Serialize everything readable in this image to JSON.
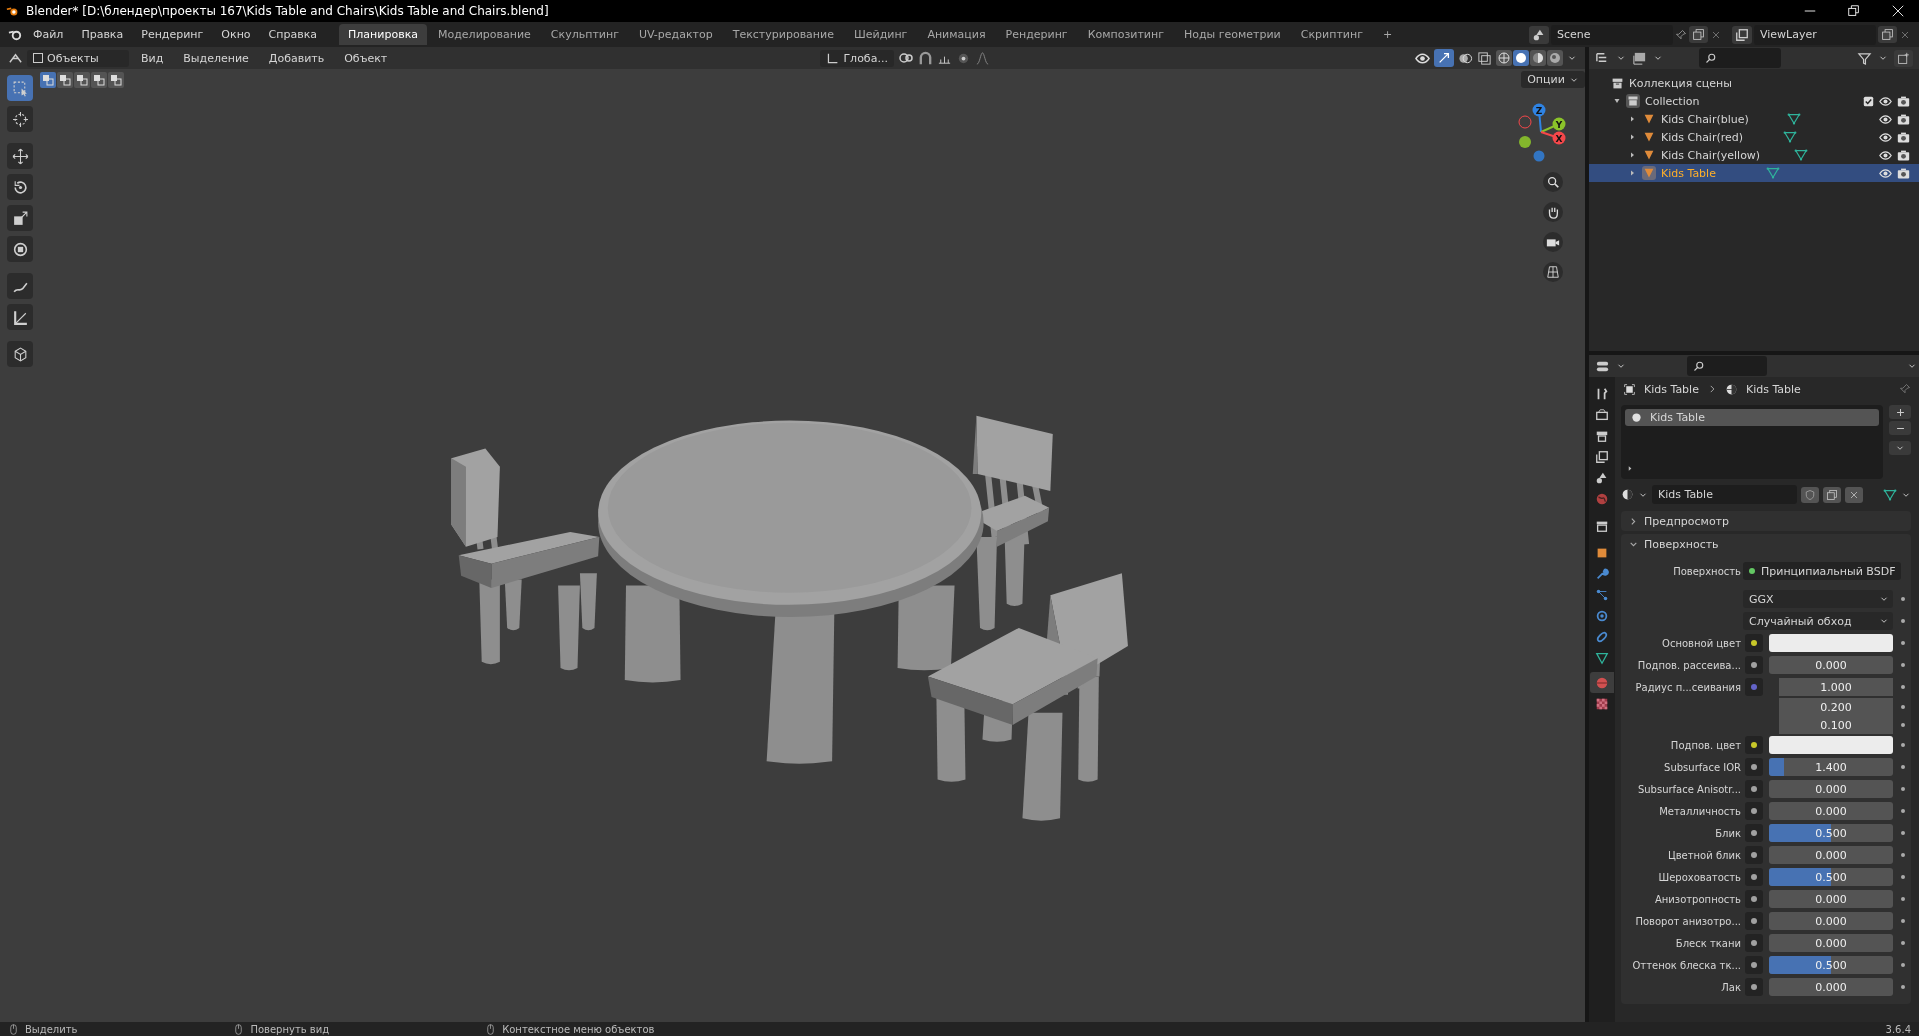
{
  "window": {
    "title": "Blender* [D:\\блендер\\проекты 167\\Kids Table and Chairs\\Kids Table and Chairs.blend]"
  },
  "menu": [
    "Файл",
    "Правка",
    "Рендеринг",
    "Окно",
    "Справка"
  ],
  "workspaces": [
    {
      "label": "Планировка",
      "selected": true
    },
    {
      "label": "Моделирование",
      "selected": false
    },
    {
      "label": "Скульптинг",
      "selected": false
    },
    {
      "label": "UV-редактор",
      "selected": false
    },
    {
      "label": "Текстурирование",
      "selected": false
    },
    {
      "label": "Шейдинг",
      "selected": false
    },
    {
      "label": "Анимация",
      "selected": false
    },
    {
      "label": "Рендеринг",
      "selected": false
    },
    {
      "label": "Композитинг",
      "selected": false
    },
    {
      "label": "Ноды геометрии",
      "selected": false
    },
    {
      "label": "Скриптинг",
      "selected": false
    }
  ],
  "add_workspace": "+",
  "scene": "Scene",
  "view_layer": "ViewLayer",
  "viewport": {
    "mode": "Объекты",
    "menus": [
      "Вид",
      "Выделение",
      "Добавить",
      "Объект"
    ],
    "orientation": "Глоба...",
    "options": "Опции",
    "select_modes": [
      {
        "selected": true
      },
      {
        "selected": false
      },
      {
        "selected": false
      },
      {
        "selected": false
      },
      {
        "selected": false
      }
    ],
    "tools": [
      {
        "kind": "select",
        "selected": true
      },
      {
        "kind": "cursor",
        "selected": false
      },
      {
        "kind": "move",
        "selected": false
      },
      {
        "kind": "rotate",
        "selected": false
      },
      {
        "kind": "scale",
        "selected": false
      },
      {
        "kind": "transform",
        "selected": false
      },
      {
        "kind": "annotate",
        "selected": false
      },
      {
        "kind": "measure",
        "selected": false
      },
      {
        "kind": "add-cube",
        "selected": false
      }
    ],
    "shading": [
      {
        "kind": "wireframe",
        "selected": false
      },
      {
        "kind": "solid",
        "selected": true
      },
      {
        "kind": "material",
        "selected": false
      },
      {
        "kind": "rendered",
        "selected": false
      }
    ],
    "gizmo_axes": [
      "Z",
      "Y",
      "X"
    ]
  },
  "outliner": {
    "root": "Коллекция сцены",
    "collection": {
      "label": "Collection",
      "expanded": true,
      "children": [
        {
          "label": "Kids Chair(blue)",
          "selected": false
        },
        {
          "label": "Kids Chair(red)",
          "selected": false
        },
        {
          "label": "Kids Chair(yellow)",
          "selected": false
        },
        {
          "label": "Kids Table",
          "selected": true
        }
      ]
    }
  },
  "properties": {
    "tabs": [
      {
        "kind": "tool",
        "selected": false
      },
      {
        "kind": "render",
        "selected": false
      },
      {
        "kind": "output",
        "selected": false
      },
      {
        "kind": "view-layer",
        "selected": false
      },
      {
        "kind": "scene",
        "selected": false
      },
      {
        "kind": "world",
        "selected": false
      },
      {
        "kind": "collection",
        "selected": false
      },
      {
        "kind": "object",
        "selected": false
      },
      {
        "kind": "modifier",
        "selected": false
      },
      {
        "kind": "particles",
        "selected": false
      },
      {
        "kind": "physics",
        "selected": false
      },
      {
        "kind": "constraints",
        "selected": false
      },
      {
        "kind": "data",
        "selected": false
      },
      {
        "kind": "material",
        "selected": true
      },
      {
        "kind": "texture",
        "selected": false
      }
    ],
    "breadcrumb": [
      "Kids Table",
      "Kids Table"
    ],
    "slots": [
      {
        "label": "Kids Table",
        "selected": true
      }
    ],
    "material": "Kids Table",
    "panels": [
      {
        "label": "Предпросмотр",
        "expanded": false
      },
      {
        "label": "Поверхность",
        "expanded": true
      }
    ],
    "rows": [
      {
        "kind": "shader",
        "label": "Поверхность",
        "value": "Принципиальный BSDF"
      },
      {
        "kind": "enum",
        "value": "GGX"
      },
      {
        "kind": "enum",
        "value": "Случайный обход"
      },
      {
        "kind": "color",
        "label": "Основной цвет",
        "color": "#ececec"
      },
      {
        "kind": "number",
        "label": "Подпов. рассеива...",
        "value": "0.000"
      },
      {
        "kind": "vector",
        "label": "Радиус п...сеивания",
        "values": [
          "1.000",
          "0.200",
          "0.100"
        ]
      },
      {
        "kind": "color",
        "label": "Подпов. цвет",
        "color": "#ececec"
      },
      {
        "kind": "number",
        "label": "Subsurface IOR",
        "value": "1.400",
        "level": 0.12
      },
      {
        "kind": "number",
        "label": "Subsurface Anisotr...",
        "value": "0.000"
      },
      {
        "kind": "number",
        "label": "Металличность",
        "value": "0.000"
      },
      {
        "kind": "number",
        "label": "Блик",
        "value": "0.500",
        "level": 0.5
      },
      {
        "kind": "number",
        "label": "Цветной блик",
        "value": "0.000"
      },
      {
        "kind": "number",
        "label": "Шероховатость",
        "value": "0.500",
        "level": 0.5
      },
      {
        "kind": "number",
        "label": "Анизотропность",
        "value": "0.000"
      },
      {
        "kind": "number",
        "label": "Поворот анизотро...",
        "value": "0.000"
      },
      {
        "kind": "number",
        "label": "Блеск ткани",
        "value": "0.000"
      },
      {
        "kind": "number",
        "label": "Оттенок блеска тк...",
        "value": "0.500",
        "level": 0.5
      },
      {
        "kind": "number",
        "label": "Лак",
        "value": "0.000"
      }
    ]
  },
  "status_bar": {
    "hints": [
      "Выделить",
      "Повернуть вид",
      "Контекстное меню объектов"
    ],
    "version": "3.6.4"
  }
}
